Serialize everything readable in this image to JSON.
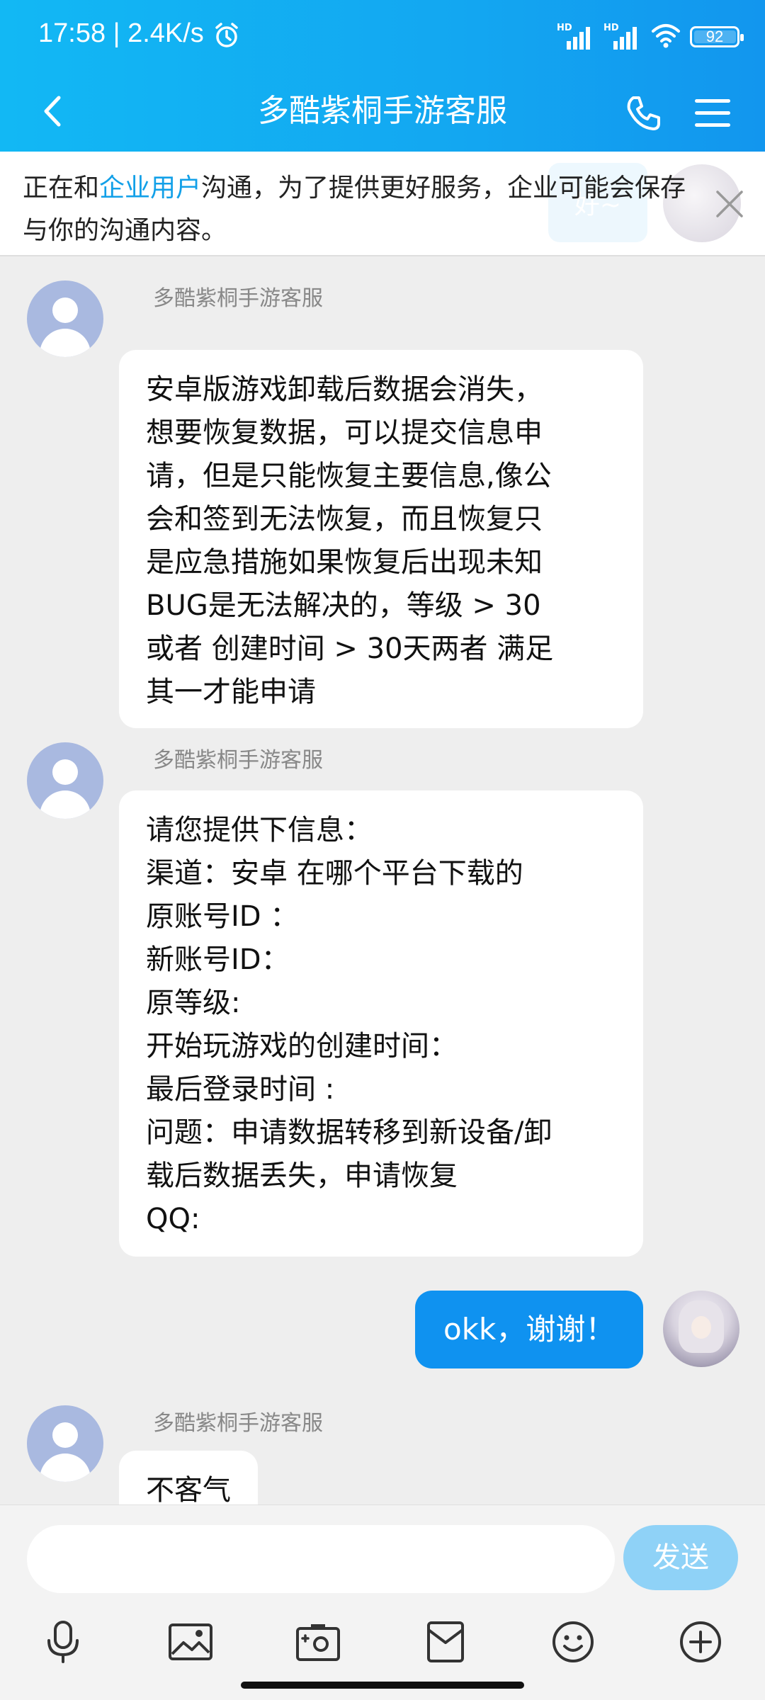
{
  "status_bar": {
    "time_speed": "17:58 | 2.4K/s",
    "signal_1_label": "HD",
    "signal_2_label": "HD",
    "battery": "92"
  },
  "header": {
    "title": "多酷紫桐手游客服"
  },
  "notice": {
    "text_before": "正在和",
    "highlight": "企业用户",
    "text_after": "沟通，为了提供更好服务，企业可能会保存与你的沟通内容。",
    "background_bubble_text": "好~"
  },
  "messages": [
    {
      "sender": "多酷紫桐手游客服",
      "text": "安卓版游戏卸载后数据会消失，\n想要恢复数据，可以提交信息申\n请，但是只能恢复主要信息,像公\n会和签到无法恢复，而且恢复只\n是应急措施如果恢复后出现未知\nBUG是无法解决的，等级 > 30\n或者 创建时间 > 30天两者 满足\n其一才能申请"
    },
    {
      "sender": "多酷紫桐手游客服",
      "text": "请您提供下信息：\n渠道：安卓  在哪个平台下载的\n原账号ID ：\n新账号ID：\n原等级:\n开始玩游戏的创建时间：\n最后登录时间 :\n问题：申请数据转移到新设备/卸\n载后数据丢失，申请恢复\nQQ:"
    },
    {
      "outgoing": true,
      "text": "okk，谢谢！"
    },
    {
      "sender": "多酷紫桐手游客服",
      "text": "不客气"
    }
  ],
  "input": {
    "placeholder": "",
    "send_label": "发送"
  },
  "toolbar_icons": [
    "microphone-icon",
    "image-icon",
    "camera-icon",
    "file-icon",
    "emoji-icon",
    "plus-icon"
  ],
  "colors": {
    "header": "#13a7f1",
    "outgoing_bubble": "#0f92f0",
    "send_button": "#8fd2f7",
    "highlight": "#12a0e8"
  }
}
